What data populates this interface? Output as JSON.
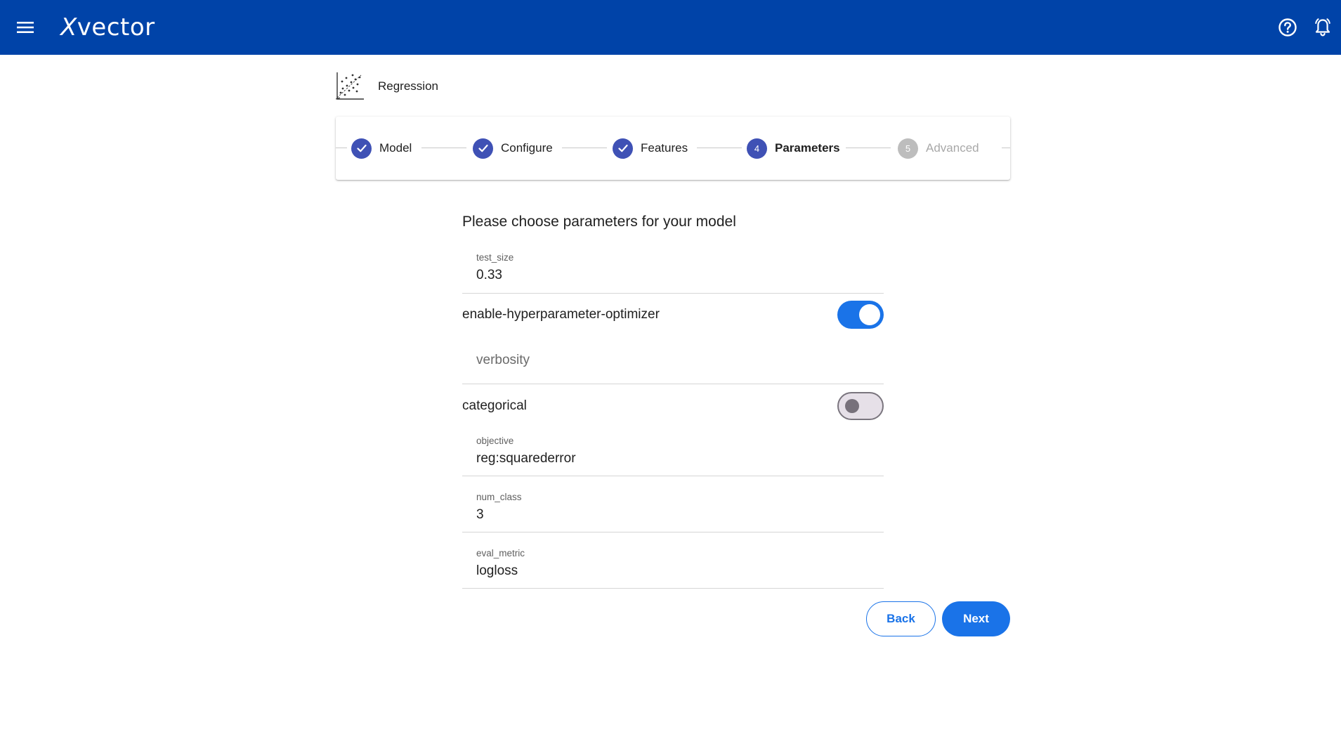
{
  "app": {
    "logo_x": "X",
    "logo_rest": "vector"
  },
  "header": {
    "title": "Regression",
    "icon": "scatter-plot-icon"
  },
  "stepper": {
    "steps": [
      {
        "number": "1",
        "label": "Model",
        "state": "done"
      },
      {
        "number": "2",
        "label": "Configure",
        "state": "done"
      },
      {
        "number": "3",
        "label": "Features",
        "state": "done"
      },
      {
        "number": "4",
        "label": "Parameters",
        "state": "active"
      },
      {
        "number": "5",
        "label": "Advanced",
        "state": "pending"
      }
    ]
  },
  "form": {
    "heading": "Please choose parameters for your model",
    "test_size": {
      "label": "test_size",
      "value": "0.33"
    },
    "hyperopt": {
      "label": "enable-hyperparameter-optimizer",
      "enabled": true
    },
    "verbosity": {
      "placeholder": "verbosity"
    },
    "categorical": {
      "label": "categorical",
      "enabled": false
    },
    "objective": {
      "label": "objective",
      "value": "reg:squarederror"
    },
    "num_class": {
      "label": "num_class",
      "value": "3"
    },
    "eval_metric": {
      "label": "eval_metric",
      "value": "logloss"
    }
  },
  "actions": {
    "back_label": "Back",
    "next_label": "Next"
  },
  "colors": {
    "appbar": "#0043a8",
    "step_done": "#3f51b5",
    "primary": "#1a73e8"
  }
}
